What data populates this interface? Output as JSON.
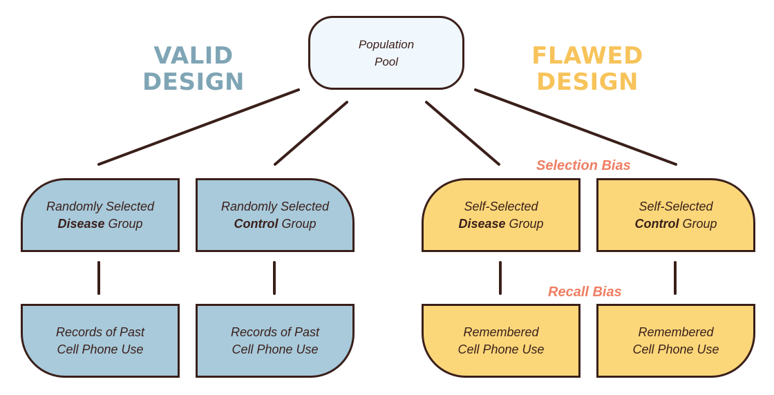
{
  "titles": {
    "valid": [
      "VALID",
      "DESIGN"
    ],
    "flawed": [
      "FLAWED",
      "DESIGN"
    ]
  },
  "colors": {
    "valid_title": "#7fa5b5",
    "flawed_title": "#f7c35a",
    "valid_fill": "#a8cadb",
    "flawed_fill": "#fbd77a",
    "pool_fill": "#f0f7fd",
    "bias_label": "#ef7e63",
    "outline": "#3a1f1a"
  },
  "pool": {
    "line1": "Population",
    "line2": "Pool"
  },
  "valid": {
    "disease_group": {
      "line1": "Randomly Selected",
      "bold": "Disease",
      "rest": " Group"
    },
    "control_group": {
      "line1": "Randomly Selected",
      "bold": "Control",
      "rest": " Group"
    },
    "disease_records": {
      "line1": "Records of Past",
      "line2": "Cell Phone Use"
    },
    "control_records": {
      "line1": "Records of Past",
      "line2": "Cell Phone Use"
    }
  },
  "flawed": {
    "disease_group": {
      "line1": "Self-Selected",
      "bold": "Disease",
      "rest": " Group"
    },
    "control_group": {
      "line1": "Self-Selected",
      "bold": "Control",
      "rest": " Group"
    },
    "disease_records": {
      "line1": "Remembered",
      "line2": "Cell Phone Use"
    },
    "control_records": {
      "line1": "Remembered",
      "line2": "Cell Phone Use"
    }
  },
  "bias_labels": {
    "selection": "Selection Bias",
    "recall": "Recall Bias"
  }
}
